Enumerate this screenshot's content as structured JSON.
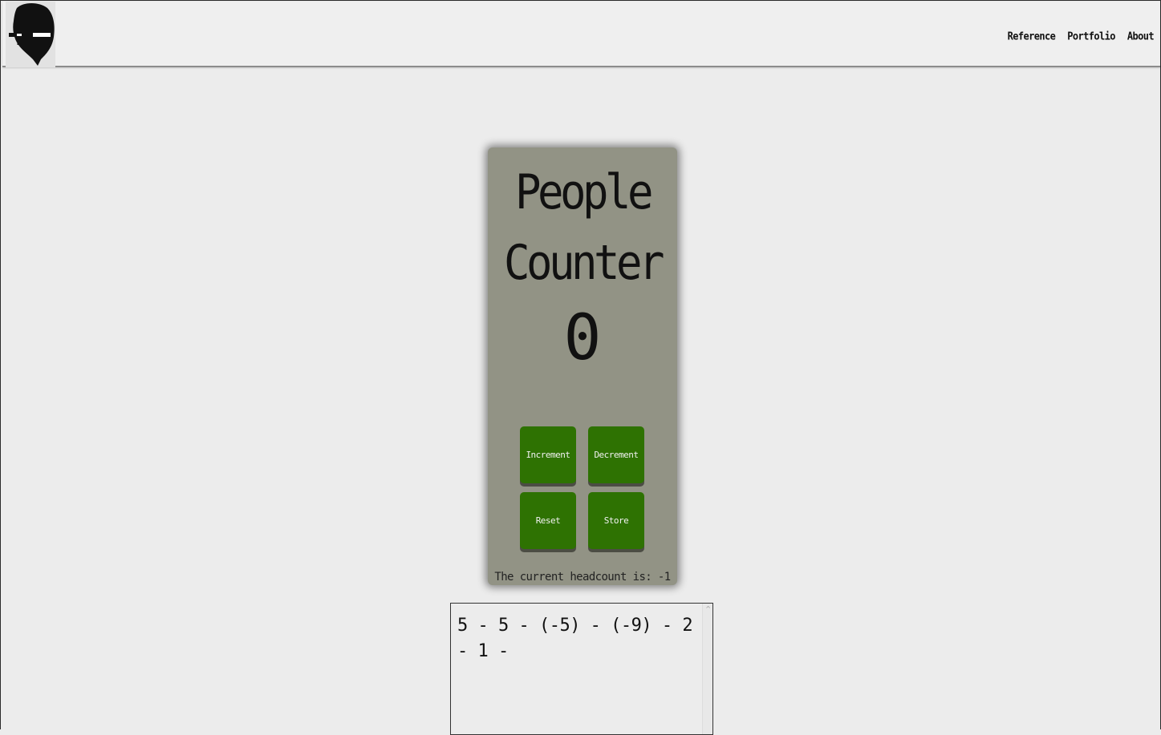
{
  "nav": {
    "items": [
      {
        "label": "Reference"
      },
      {
        "label": "Portfolio"
      },
      {
        "label": "About"
      }
    ]
  },
  "logo": {
    "icon": "plus-minus-head-logo",
    "color": "#111111"
  },
  "counter": {
    "title_line1": "People",
    "title_line2": "Counter",
    "value": "0",
    "buttons": {
      "increment": "Increment",
      "decrement": "Decrement",
      "reset": "Reset",
      "store": "Store"
    },
    "headcount_text": "The current headcount is: -1"
  },
  "log": {
    "text": "5 - 5 - (-5) - (-9) - 2 - 1 -"
  },
  "colors": {
    "card": "#929385",
    "button": "#2e7202",
    "background": "#ececec"
  }
}
